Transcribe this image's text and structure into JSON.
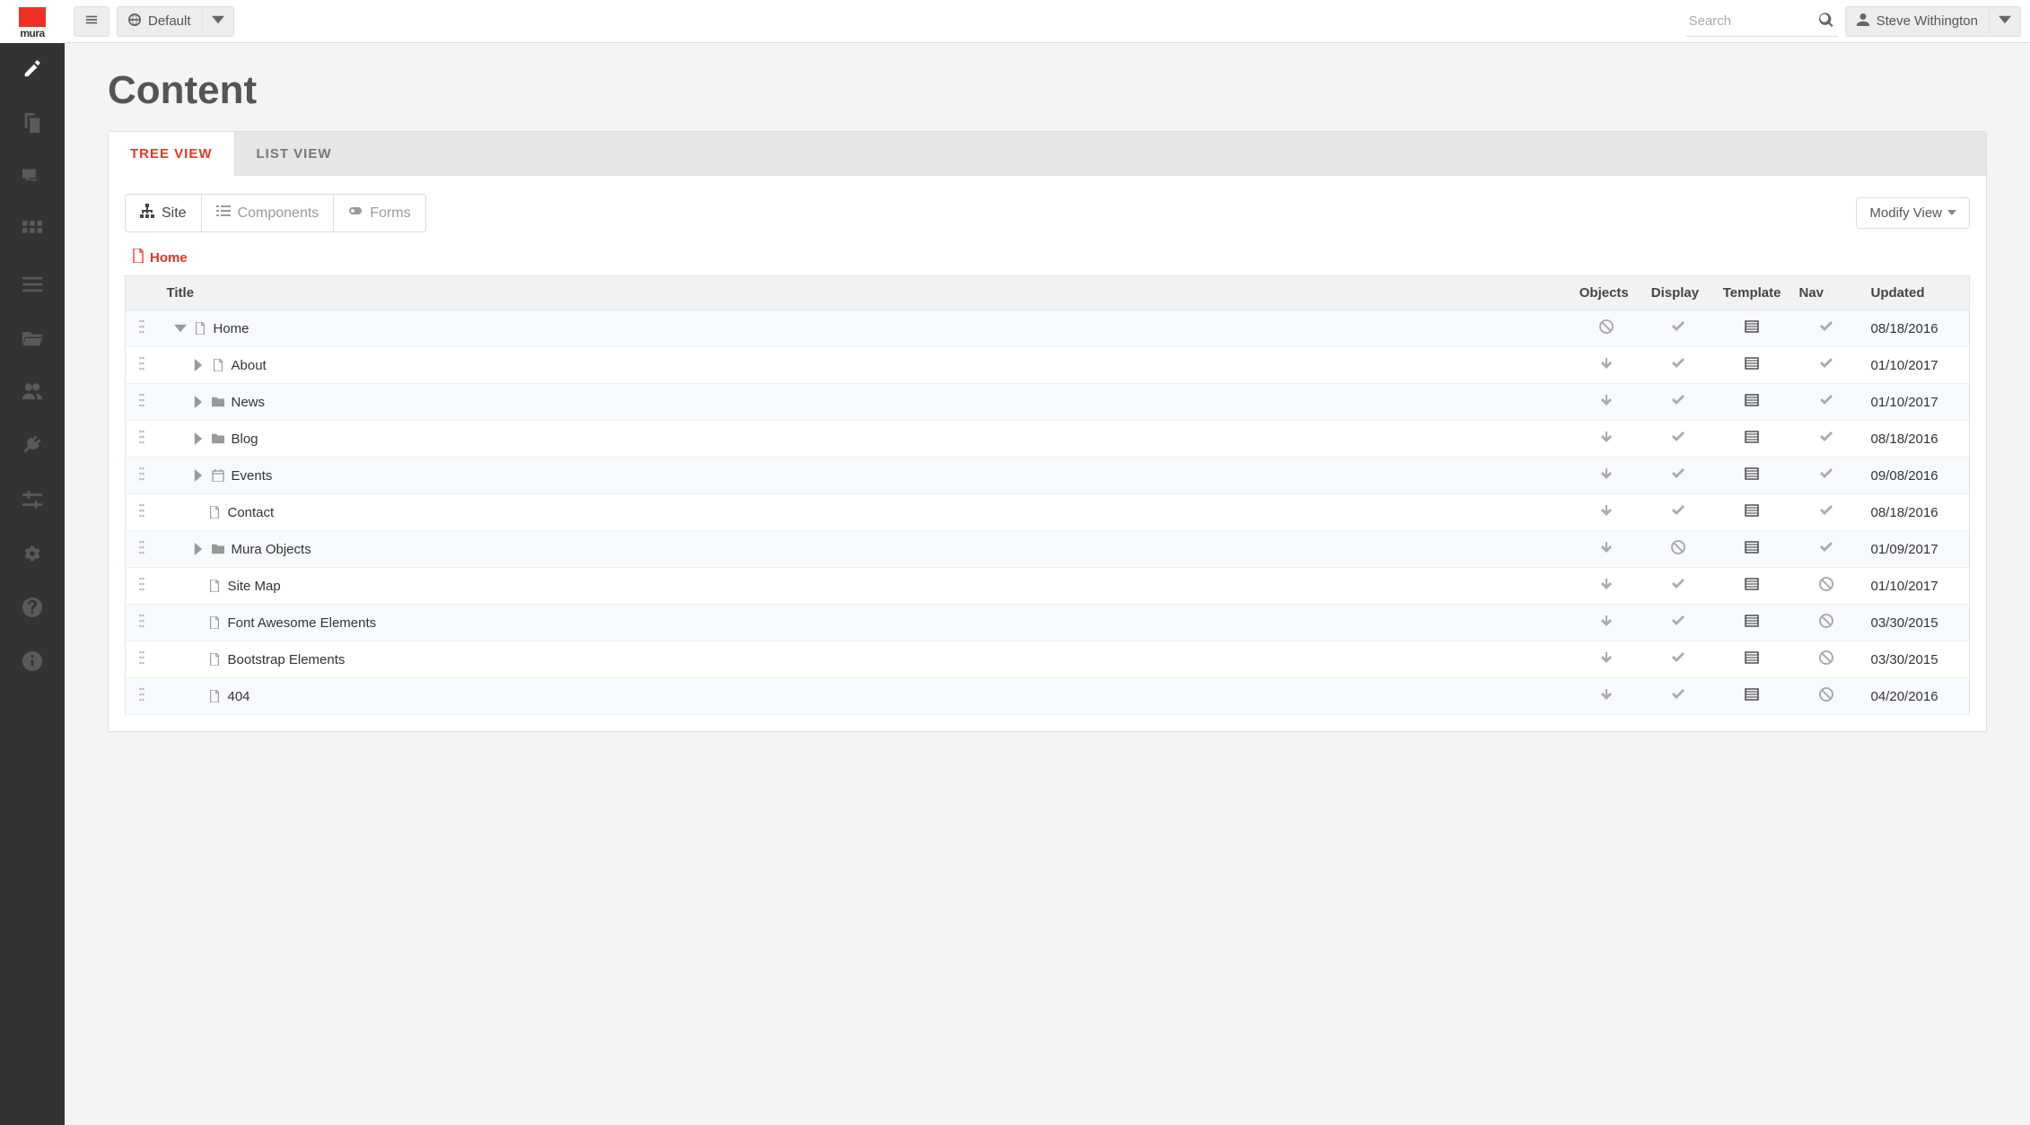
{
  "topbar": {
    "site_selector_label": "Default",
    "search_placeholder": "Search",
    "user_name": "Steve Withington"
  },
  "page": {
    "title": "Content",
    "tabs": [
      {
        "label": "TREE VIEW",
        "active": true
      },
      {
        "label": "LIST VIEW",
        "active": false
      }
    ],
    "segments": [
      {
        "label": "Site",
        "icon": "sitemap-icon",
        "active": true
      },
      {
        "label": "Components",
        "icon": "list-icon",
        "active": false
      },
      {
        "label": "Forms",
        "icon": "toggle-icon",
        "active": false
      }
    ],
    "modify_view_label": "Modify View",
    "breadcrumb": "Home",
    "columns": {
      "title": "Title",
      "objects": "Objects",
      "display": "Display",
      "template": "Template",
      "nav": "Nav",
      "updated": "Updated"
    },
    "rows": [
      {
        "title": "Home",
        "indent": 0,
        "expandable": true,
        "expanded": true,
        "icon": "page-icon",
        "objects": "ban",
        "display": "check",
        "template": "layout",
        "nav": "check",
        "updated": "08/18/2016"
      },
      {
        "title": "About",
        "indent": 1,
        "expandable": true,
        "expanded": false,
        "icon": "page-icon",
        "objects": "down",
        "display": "check",
        "template": "layout",
        "nav": "check",
        "updated": "01/10/2017"
      },
      {
        "title": "News",
        "indent": 1,
        "expandable": true,
        "expanded": false,
        "icon": "folder-icon",
        "objects": "down",
        "display": "check",
        "template": "layout",
        "nav": "check",
        "updated": "01/10/2017"
      },
      {
        "title": "Blog",
        "indent": 1,
        "expandable": true,
        "expanded": false,
        "icon": "folder-icon",
        "objects": "down",
        "display": "check",
        "template": "layout",
        "nav": "check",
        "updated": "08/18/2016"
      },
      {
        "title": "Events",
        "indent": 1,
        "expandable": true,
        "expanded": false,
        "icon": "calendar-icon",
        "objects": "down",
        "display": "check",
        "template": "layout",
        "nav": "check",
        "updated": "09/08/2016"
      },
      {
        "title": "Contact",
        "indent": 1,
        "expandable": false,
        "icon": "page-icon",
        "objects": "down",
        "display": "check",
        "template": "layout",
        "nav": "check",
        "updated": "08/18/2016"
      },
      {
        "title": "Mura Objects",
        "indent": 1,
        "expandable": true,
        "expanded": false,
        "icon": "folder-icon",
        "objects": "down",
        "display": "ban",
        "template": "layout",
        "nav": "check",
        "updated": "01/09/2017"
      },
      {
        "title": "Site Map",
        "indent": 1,
        "expandable": false,
        "icon": "page-icon",
        "objects": "down",
        "display": "check",
        "template": "layout",
        "nav": "ban",
        "updated": "01/10/2017"
      },
      {
        "title": "Font Awesome Elements",
        "indent": 1,
        "expandable": false,
        "icon": "page-icon",
        "objects": "down",
        "display": "check",
        "template": "layout",
        "nav": "ban",
        "updated": "03/30/2015"
      },
      {
        "title": "Bootstrap Elements",
        "indent": 1,
        "expandable": false,
        "icon": "page-icon",
        "objects": "down",
        "display": "check",
        "template": "layout",
        "nav": "ban",
        "updated": "03/30/2015"
      },
      {
        "title": "404",
        "indent": 1,
        "expandable": false,
        "icon": "page-icon",
        "objects": "down",
        "display": "check",
        "template": "layout",
        "nav": "ban",
        "updated": "04/20/2016"
      }
    ]
  },
  "sidebar": {
    "items": [
      {
        "name": "content",
        "icon": "edit-icon",
        "active": true
      },
      {
        "name": "copy",
        "icon": "copy-icon"
      },
      {
        "name": "comments",
        "icon": "comments-icon"
      },
      {
        "name": "modules",
        "icon": "grid-icon"
      },
      {
        "name": "lists",
        "icon": "listlines-icon"
      },
      {
        "name": "files",
        "icon": "folderopen-icon"
      },
      {
        "name": "users",
        "icon": "users-icon"
      },
      {
        "name": "plugins",
        "icon": "plug-icon"
      },
      {
        "name": "settings",
        "icon": "sliders-icon"
      },
      {
        "name": "gears",
        "icon": "gears-icon"
      },
      {
        "name": "help",
        "icon": "question-icon"
      },
      {
        "name": "info",
        "icon": "info-icon"
      }
    ]
  }
}
